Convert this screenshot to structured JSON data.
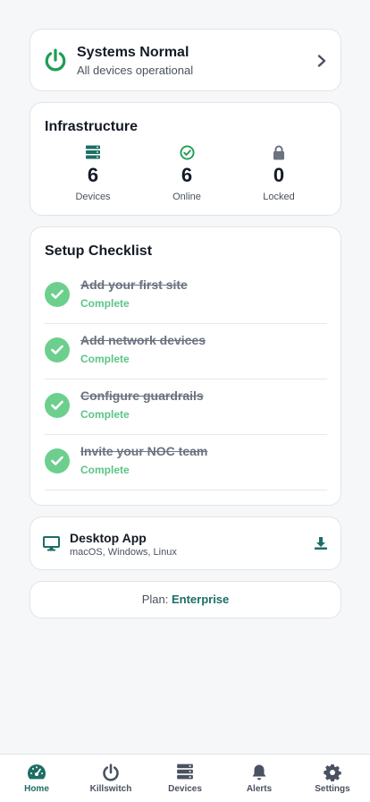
{
  "status": {
    "title": "Systems Normal",
    "subtitle": "All devices operational",
    "icon": "power-icon",
    "color": "#1f9d55"
  },
  "infrastructure": {
    "title": "Infrastructure",
    "stats": [
      {
        "value": "6",
        "label": "Devices",
        "icon": "server-icon",
        "color": "#1d6e65"
      },
      {
        "value": "6",
        "label": "Online",
        "icon": "check-circle-icon",
        "color": "#1f9d55"
      },
      {
        "value": "0",
        "label": "Locked",
        "icon": "lock-icon",
        "color": "#6b7280"
      }
    ]
  },
  "checklist": {
    "title": "Setup Checklist",
    "items": [
      {
        "label": "Add your first site",
        "status": "Complete"
      },
      {
        "label": "Add network devices",
        "status": "Complete"
      },
      {
        "label": "Configure guardrails",
        "status": "Complete"
      },
      {
        "label": "Invite your NOC team",
        "status": "Complete"
      }
    ]
  },
  "desktop": {
    "title": "Desktop App",
    "subtitle": "macOS, Windows, Linux"
  },
  "plan": {
    "label": "Plan:",
    "value": "Enterprise"
  },
  "nav": {
    "items": [
      {
        "label": "Home",
        "icon": "dashboard-gauge-icon",
        "active": true
      },
      {
        "label": "Killswitch",
        "icon": "power-icon"
      },
      {
        "label": "Devices",
        "icon": "server-icon"
      },
      {
        "label": "Alerts",
        "icon": "bell-icon"
      },
      {
        "label": "Settings",
        "icon": "gear-icon"
      }
    ]
  },
  "colors": {
    "accent": "#1d6e65",
    "success": "#1f9d55",
    "complete": "#5cc488",
    "background": "#f6f7f9"
  }
}
